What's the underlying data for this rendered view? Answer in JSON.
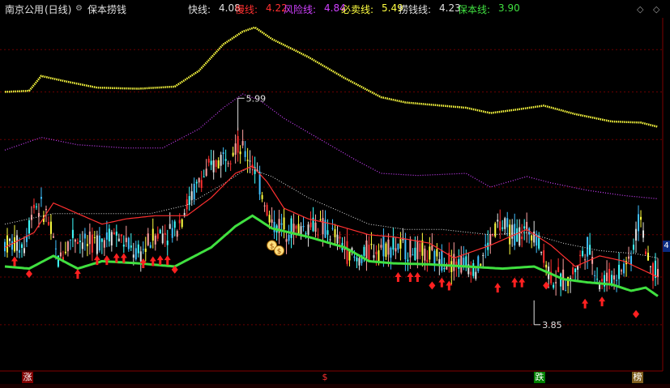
{
  "header": {
    "stock_name": "南京公用",
    "period": "(日线)",
    "indicator_name": "保本捞钱",
    "lines": [
      {
        "label": "快线:",
        "value": "4.08",
        "color": "#e0e0e0"
      },
      {
        "label": "慢线:",
        "value": "4.22",
        "color": "#ff3030"
      },
      {
        "label": "风险线:",
        "value": "4.84",
        "color": "#d040ff"
      },
      {
        "label": "必卖线:",
        "value": "5.49",
        "color": "#ffff40"
      },
      {
        "label": "捞钱线:",
        "value": "4.23",
        "color": "#e0e0e0"
      },
      {
        "label": "保本线:",
        "value": "3.90",
        "color": "#40e040"
      }
    ]
  },
  "corner_icons": [
    "diamond-icon",
    "diamond-icon"
  ],
  "scale_tag": "4",
  "bottom_signals": [
    {
      "text": "涨",
      "bg": "#800000",
      "color": "#ffffff"
    },
    {
      "text": "$",
      "bg": "#000000",
      "color": "#ff3030"
    },
    {
      "text": "跌",
      "bg": "#008000",
      "color": "#ffffff"
    },
    {
      "text": "榜",
      "bg": "#806020",
      "color": "#ffffff"
    }
  ],
  "chart_data": {
    "type": "line",
    "ylim": [
      3.55,
      6.75
    ],
    "n_bars": 270,
    "annotations": [
      {
        "text": "5.99",
        "type": "high",
        "value": 5.99
      },
      {
        "text": "3.85",
        "type": "low",
        "value": 3.85
      }
    ],
    "grid_levels": [
      6.45,
      6.05,
      5.6,
      5.15,
      4.7,
      4.3,
      3.85
    ],
    "series": [
      {
        "name": "必卖线",
        "color": "#ffff40",
        "points": [
          [
            0,
            6.05
          ],
          [
            10,
            6.06
          ],
          [
            15,
            6.2
          ],
          [
            25,
            6.15
          ],
          [
            38,
            6.09
          ],
          [
            55,
            6.08
          ],
          [
            70,
            6.1
          ],
          [
            80,
            6.25
          ],
          [
            90,
            6.5
          ],
          [
            98,
            6.62
          ],
          [
            103,
            6.66
          ],
          [
            110,
            6.55
          ],
          [
            125,
            6.38
          ],
          [
            140,
            6.18
          ],
          [
            155,
            6.0
          ],
          [
            165,
            5.95
          ],
          [
            175,
            5.93
          ],
          [
            190,
            5.9
          ],
          [
            200,
            5.85
          ],
          [
            210,
            5.88
          ],
          [
            222,
            5.92
          ],
          [
            235,
            5.84
          ],
          [
            250,
            5.77
          ],
          [
            262,
            5.76
          ],
          [
            269,
            5.72
          ]
        ]
      },
      {
        "name": "风险线",
        "color": "#d040ff",
        "points": [
          [
            0,
            5.5
          ],
          [
            15,
            5.62
          ],
          [
            30,
            5.55
          ],
          [
            50,
            5.52
          ],
          [
            65,
            5.52
          ],
          [
            80,
            5.7
          ],
          [
            90,
            5.9
          ],
          [
            98,
            6.03
          ],
          [
            105,
            5.97
          ],
          [
            115,
            5.8
          ],
          [
            130,
            5.6
          ],
          [
            145,
            5.4
          ],
          [
            155,
            5.28
          ],
          [
            170,
            5.26
          ],
          [
            190,
            5.28
          ],
          [
            200,
            5.15
          ],
          [
            215,
            5.25
          ],
          [
            225,
            5.19
          ],
          [
            240,
            5.12
          ],
          [
            255,
            5.07
          ],
          [
            269,
            5.04
          ]
        ]
      },
      {
        "name": "捞钱线",
        "color": "#e0e0e0",
        "points": [
          [
            0,
            4.8
          ],
          [
            20,
            4.9
          ],
          [
            40,
            4.9
          ],
          [
            60,
            4.9
          ],
          [
            75,
            4.98
          ],
          [
            90,
            5.18
          ],
          [
            100,
            5.33
          ],
          [
            110,
            5.25
          ],
          [
            125,
            5.05
          ],
          [
            140,
            4.9
          ],
          [
            150,
            4.8
          ],
          [
            165,
            4.75
          ],
          [
            180,
            4.75
          ],
          [
            200,
            4.7
          ],
          [
            215,
            4.72
          ],
          [
            230,
            4.62
          ],
          [
            245,
            4.55
          ],
          [
            260,
            4.52
          ],
          [
            269,
            4.48
          ]
        ]
      },
      {
        "name": "慢线",
        "color": "#ff3030",
        "points": [
          [
            0,
            4.58
          ],
          [
            12,
            4.72
          ],
          [
            20,
            5.0
          ],
          [
            30,
            4.9
          ],
          [
            40,
            4.8
          ],
          [
            50,
            4.85
          ],
          [
            62,
            4.88
          ],
          [
            75,
            4.88
          ],
          [
            85,
            5.05
          ],
          [
            95,
            5.28
          ],
          [
            102,
            5.35
          ],
          [
            108,
            5.2
          ],
          [
            115,
            4.95
          ],
          [
            125,
            4.85
          ],
          [
            135,
            4.8
          ],
          [
            150,
            4.7
          ],
          [
            160,
            4.68
          ],
          [
            175,
            4.62
          ],
          [
            185,
            4.48
          ],
          [
            200,
            4.6
          ],
          [
            215,
            4.75
          ],
          [
            225,
            4.6
          ],
          [
            235,
            4.4
          ],
          [
            245,
            4.5
          ],
          [
            255,
            4.45
          ],
          [
            269,
            4.3
          ]
        ]
      },
      {
        "name": "保本线",
        "color": "#40e040",
        "points": [
          [
            0,
            4.4
          ],
          [
            10,
            4.38
          ],
          [
            20,
            4.5
          ],
          [
            30,
            4.38
          ],
          [
            40,
            4.45
          ],
          [
            55,
            4.43
          ],
          [
            70,
            4.4
          ],
          [
            85,
            4.58
          ],
          [
            95,
            4.78
          ],
          [
            102,
            4.88
          ],
          [
            110,
            4.76
          ],
          [
            125,
            4.68
          ],
          [
            140,
            4.58
          ],
          [
            150,
            4.45
          ],
          [
            160,
            4.43
          ],
          [
            175,
            4.42
          ],
          [
            190,
            4.4
          ],
          [
            205,
            4.38
          ],
          [
            218,
            4.4
          ],
          [
            230,
            4.28
          ],
          [
            240,
            4.25
          ],
          [
            250,
            4.23
          ],
          [
            258,
            4.17
          ],
          [
            264,
            4.2
          ],
          [
            269,
            4.12
          ]
        ]
      },
      {
        "name": "快线",
        "color": "#e0e0e0",
        "points": [
          [
            0,
            4.62
          ],
          [
            8,
            4.6
          ],
          [
            12,
            5.0
          ],
          [
            17,
            4.9
          ],
          [
            22,
            4.45
          ],
          [
            28,
            4.7
          ],
          [
            35,
            4.6
          ],
          [
            45,
            4.72
          ],
          [
            55,
            4.5
          ],
          [
            62,
            4.7
          ],
          [
            70,
            4.75
          ],
          [
            80,
            5.2
          ],
          [
            88,
            5.4
          ],
          [
            95,
            5.55
          ],
          [
            102,
            5.4
          ],
          [
            106,
            5.1
          ],
          [
            110,
            4.8
          ],
          [
            120,
            4.75
          ],
          [
            128,
            4.8
          ],
          [
            135,
            4.7
          ],
          [
            145,
            4.45
          ],
          [
            150,
            4.55
          ],
          [
            158,
            4.6
          ],
          [
            168,
            4.55
          ],
          [
            175,
            4.5
          ],
          [
            185,
            4.45
          ],
          [
            195,
            4.4
          ],
          [
            203,
            4.8
          ],
          [
            210,
            4.7
          ],
          [
            218,
            4.75
          ],
          [
            225,
            4.3
          ],
          [
            232,
            4.25
          ],
          [
            240,
            4.6
          ],
          [
            245,
            4.25
          ],
          [
            252,
            4.32
          ],
          [
            258,
            4.5
          ],
          [
            262,
            4.9
          ],
          [
            265,
            4.4
          ],
          [
            269,
            4.35
          ]
        ]
      }
    ],
    "signals": [
      {
        "bar": 4,
        "marker": "arrow",
        "value": 4.45
      },
      {
        "bar": 10,
        "marker": "diamond",
        "value": 4.33
      },
      {
        "bar": 30,
        "marker": "arrow",
        "value": 4.33
      },
      {
        "bar": 38,
        "marker": "arrow",
        "value": 4.46
      },
      {
        "bar": 42,
        "marker": "arrow",
        "value": 4.46
      },
      {
        "bar": 46,
        "marker": "arrow",
        "value": 4.48
      },
      {
        "bar": 49,
        "marker": "arrow",
        "value": 4.48
      },
      {
        "bar": 57,
        "marker": "arrow",
        "value": 4.43
      },
      {
        "bar": 61,
        "marker": "arrow",
        "value": 4.45
      },
      {
        "bar": 64,
        "marker": "arrow",
        "value": 4.46
      },
      {
        "bar": 67,
        "marker": "arrow",
        "value": 4.46
      },
      {
        "bar": 70,
        "marker": "diamond",
        "value": 4.37
      },
      {
        "bar": 110,
        "marker": "money",
        "value": 4.6
      },
      {
        "bar": 113,
        "marker": "money",
        "value": 4.55
      },
      {
        "bar": 162,
        "marker": "arrow",
        "value": 4.3
      },
      {
        "bar": 167,
        "marker": "arrow",
        "value": 4.3
      },
      {
        "bar": 170,
        "marker": "arrow",
        "value": 4.3
      },
      {
        "bar": 176,
        "marker": "diamond",
        "value": 4.22
      },
      {
        "bar": 180,
        "marker": "arrow",
        "value": 4.25
      },
      {
        "bar": 183,
        "marker": "arrow",
        "value": 4.22
      },
      {
        "bar": 203,
        "marker": "arrow",
        "value": 4.2
      },
      {
        "bar": 210,
        "marker": "arrow",
        "value": 4.25
      },
      {
        "bar": 213,
        "marker": "arrow",
        "value": 4.25
      },
      {
        "bar": 223,
        "marker": "diamond",
        "value": 4.22
      },
      {
        "bar": 239,
        "marker": "arrow",
        "value": 4.05
      },
      {
        "bar": 246,
        "marker": "arrow",
        "value": 4.07
      },
      {
        "bar": 260,
        "marker": "diamond",
        "value": 3.95
      }
    ]
  }
}
